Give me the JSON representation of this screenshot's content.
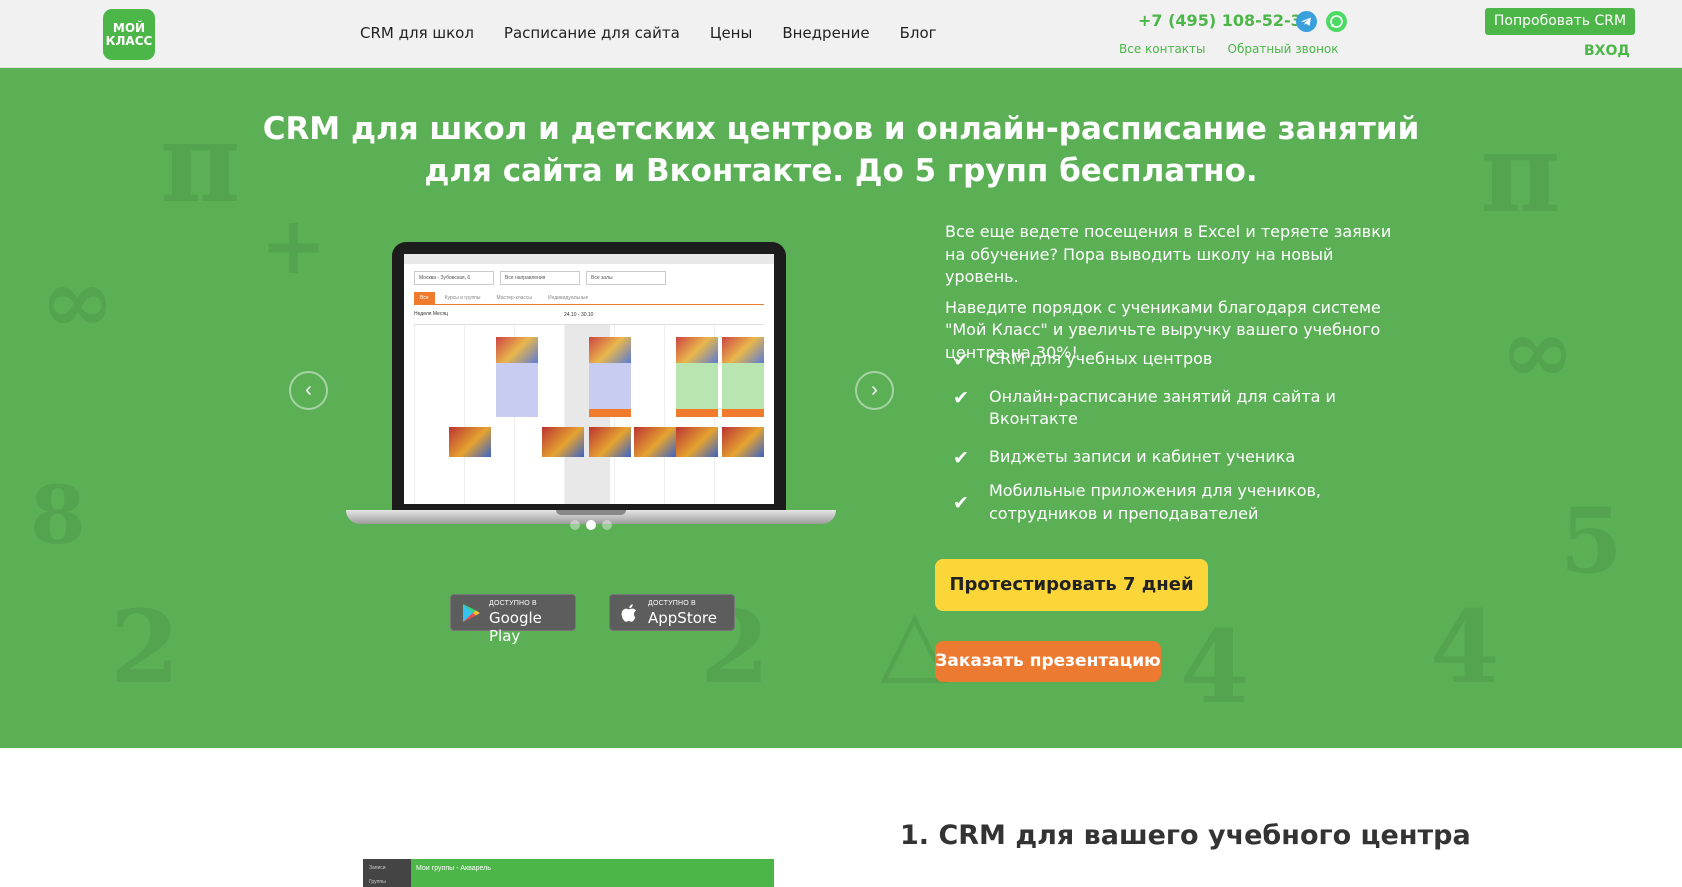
{
  "header": {
    "logo_text": "МОЙ КЛАСС",
    "nav": [
      "CRM для школ",
      "Расписание для сайта",
      "Цены",
      "Внедрение",
      "Блог"
    ],
    "phone": "+7 (495) 108-52-39",
    "messenger_icons": [
      "telegram-icon",
      "whatsapp-icon"
    ],
    "contacts_link": "Все контакты",
    "callback_link": "Обратный звонок",
    "try_button": "Попробовать CRM",
    "login": "ВХОД"
  },
  "hero": {
    "title_line1": "CRM для школ и детских центров и онлайн-расписание занятий",
    "title_line2": "для сайта и Вконтакте. До 5 групп бесплатно.",
    "intro_p1": "Все еще ведете посещения в Excel и теряете заявки на обучение? Пора выводить школу на новый уровень.",
    "intro_p2": "Наведите порядок с учениками благодаря системе \"Мой Класс\" и увеличьте выручку вашего учебного центра на 30%!",
    "features": [
      "CRM для учебных центров",
      "Онлайн-расписание занятий для сайта и Вконтакте",
      "Виджеты записи и кабинет ученика",
      "Мобильные приложения для учеников, сотрудников и преподавателей"
    ],
    "test_button": "Протестировать 7 дней",
    "presentation_button": "Заказать презентацию",
    "carousel": {
      "current_slide": 2,
      "total_slides": 3
    },
    "stores": {
      "google_small": "ДОСТУПНО В",
      "google_big": "Google Play",
      "apple_small": "ДОСТУПНО В",
      "apple_big": "AppStore"
    },
    "screen": {
      "branch": "Москва - Зубовская, 6",
      "direction": "Все направления",
      "rooms": "Все залы",
      "tabs": [
        "Все",
        "Курсы и группы",
        "Мастер-классы",
        "Индивидуальные"
      ],
      "view": "Неделя  Месяц",
      "date_range": "24.10 - 30.10"
    }
  },
  "section2": {
    "title": "1. CRM для вашего учебного центра",
    "preview_title": "Мои группы - Акварель",
    "preview_side1": "Записи",
    "preview_side2": "Группы"
  },
  "colors": {
    "brand_green": "#4cb648",
    "hero_bg": "#5bb056",
    "yellow_cta": "#fad639",
    "orange_cta": "#ec7a30"
  }
}
